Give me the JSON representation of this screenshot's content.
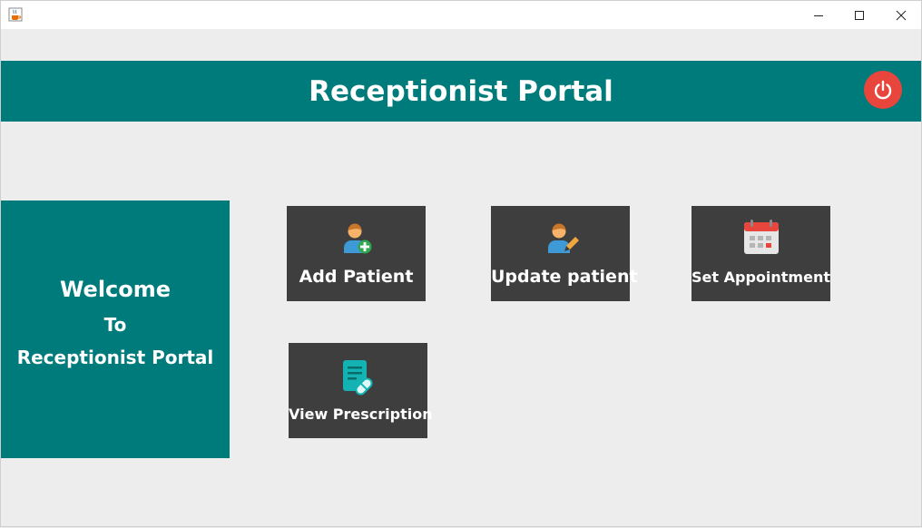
{
  "window": {
    "app_icon": "java-coffee-icon",
    "controls": [
      "minimize-icon",
      "maximize-icon",
      "close-icon"
    ]
  },
  "header": {
    "title": "Receptionist Portal",
    "power_icon": "power-icon",
    "accent": "#007b7b",
    "power_color": "#e8453c"
  },
  "welcome": {
    "line1": "Welcome",
    "line2": "To",
    "line3": "Receptionist Portal"
  },
  "tiles": [
    {
      "label": "Add Patient",
      "icon": "add-patient-icon"
    },
    {
      "label": "Update patient",
      "icon": "edit-patient-icon"
    },
    {
      "label": "Set Appointment",
      "icon": "calendar-icon"
    },
    {
      "label": "View Prescription",
      "icon": "prescription-icon"
    }
  ],
  "colors": {
    "background": "#ededed",
    "tile": "#3e3e3e"
  }
}
